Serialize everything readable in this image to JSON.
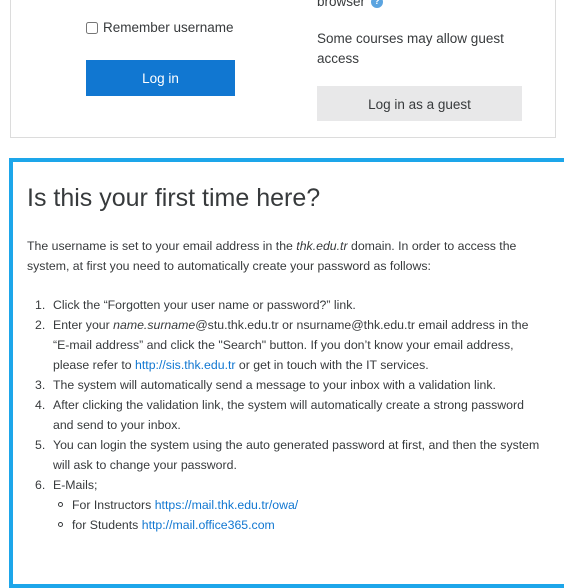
{
  "login": {
    "remember_label": "Remember username",
    "login_button": "Log in",
    "browser_text": "browser",
    "guest_note": "Some courses may allow guest access",
    "guest_button": "Log in as a guest"
  },
  "info": {
    "title": "Is this your first time here?",
    "intro_a": "The username is set to your email address in the ",
    "intro_domain": "thk.edu.tr",
    "intro_b": " domain. In order to access the system, at first you need to automatically create your password as follows:",
    "steps": {
      "s1": {
        "num": "1.",
        "text": "Click the  “Forgotten your user name or password?” link."
      },
      "s2": {
        "num": "2.",
        "a": "Enter your ",
        "italic": "name.surname",
        "b": "@stu.thk.edu.tr or nsurname@thk.edu.tr email address in the “E-mail address” and click the \"Search\" button. If you don’t know your email address, please refer to ",
        "link": "http://sis.thk.edu.tr",
        "c": " or get in touch with the IT services."
      },
      "s3": {
        "num": "3.",
        "text": "The system will automatically send a message to your inbox with a validation link."
      },
      "s4": {
        "num": "4.",
        "text": "After clicking the validation link, the system will automatically create a strong password and send to your inbox."
      },
      "s5": {
        "num": "5.",
        "text": "You can login the system using the auto generated password at first, and then the system will ask to change your password."
      },
      "s6": {
        "num": "6.",
        "text": "E-Mails;",
        "instructors_label": "For Instructors ",
        "instructors_link": "https://mail.thk.edu.tr/owa/",
        "students_label": "for Students ",
        "students_link": "http://mail.office365.com"
      }
    }
  },
  "colors": {
    "primary": "#1177d1",
    "panel_border": "#1da6ea",
    "guest_button_bg": "#e8e8e9",
    "help_icon": "#5ba4e0"
  },
  "icons": {
    "help": "question-circle-icon"
  }
}
